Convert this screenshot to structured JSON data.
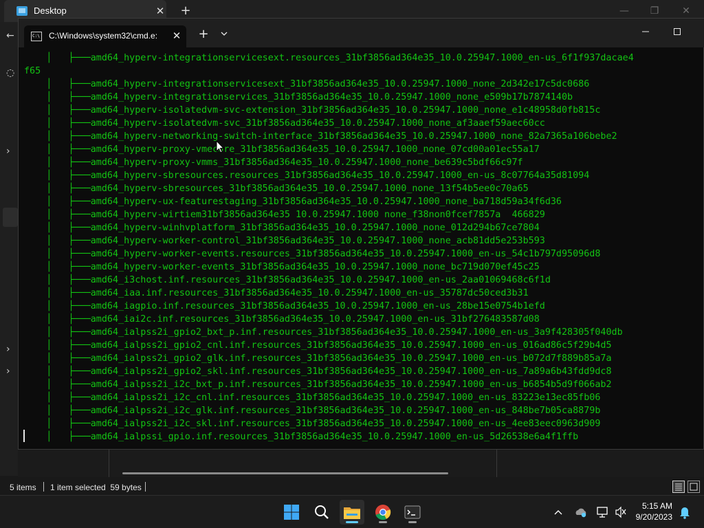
{
  "explorer": {
    "title": "Desktop",
    "close_glyph": "✕",
    "new_tab_glyph": "+",
    "status": {
      "items_count": "5 items",
      "selection": "1 item selected  59 bytes"
    },
    "icons": {
      "app": "desktop-folder-icon",
      "details_view": "details-view-icon",
      "tiles_view": "large-icons-view-icon"
    }
  },
  "terminal": {
    "tab_title": "C:\\Windows\\system32\\cmd.e:",
    "close_glyph": "✕",
    "new_tab_glyph": "+",
    "dropdown_glyph": "⌄",
    "minimize_glyph": "—",
    "maximize_glyph": "☐",
    "cmd_icon_text": "C:\\",
    "lines": [
      "    │   ├───amd64_hyperv-integrationservicesext.resources_31bf3856ad364e35_10.0.25947.1000_en-us_6f1f937dacae4",
      "f65",
      "    │   ├───amd64_hyperv-integrationservicesext_31bf3856ad364e35_10.0.25947.1000_none_2d342e17c5dc0686",
      "    │   ├───amd64_hyperv-integrationservices_31bf3856ad364e35_10.0.25947.1000_none_e509b17b7874140b",
      "    │   ├───amd64_hyperv-isolatedvm-svc-extension_31bf3856ad364e35_10.0.25947.1000_none_e1c48958d0fb815c",
      "    │   ├───amd64_hyperv-isolatedvm-svc_31bf3856ad364e35_10.0.25947.1000_none_af3aaef59aec60cc",
      "    │   ├───amd64_hyperv-networking-switch-interface_31bf3856ad364e35_10.0.25947.1000_none_82a7365a106bebe2",
      "    │   ├───amd64_hyperv-proxy-vmecore_31bf3856ad364e35_10.0.25947.1000_none_07cd00a01ec55a17",
      "    │   ├───amd64_hyperv-proxy-vmms_31bf3856ad364e35_10.0.25947.1000_none_be639c5bdf66c97f",
      "    │   ├───amd64_hyperv-sbresources.resources_31bf3856ad364e35_10.0.25947.1000_en-us_8c07764a35d81094",
      "    │   ├───amd64_hyperv-sbresources_31bf3856ad364e35_10.0.25947.1000_none_13f54b5ee0c70a65",
      "    │   ├───amd64_hyperv-ux-featurestaging_31bf3856ad364e35_10.0.25947.1000_none_ba718d59a34f6d36",
      "    │   ├───amd64_hyperv-wirtiem31bf3856ad364e35 10.0.25947.1000 none_f38non0fcef7857a  466829",
      "    │   ├───amd64_hyperv-winhvplatform_31bf3856ad364e35_10.0.25947.1000_none_012d294b67ce7804",
      "    │   ├───amd64_hyperv-worker-control_31bf3856ad364e35_10.0.25947.1000_none_acb81dd5e253b593",
      "    │   ├───amd64_hyperv-worker-events.resources_31bf3856ad364e35_10.0.25947.1000_en-us_54c1b797d95096d8",
      "    │   ├───amd64_hyperv-worker-events_31bf3856ad364e35_10.0.25947.1000_none_bc719d070ef45c25",
      "    │   ├───amd64_i3chost.inf.resources_31bf3856ad364e35_10.0.25947.1000_en-us_2aa01069468c6f1d",
      "    │   ├───amd64_iaa.inf.resources_31bf3856ad364e35_10.0.25947.1000_en-us_35787dc50ced3b31",
      "    │   ├───amd64_iagpio.inf.resources_31bf3856ad364e35_10.0.25947.1000_en-us_28be15e0754b1efd",
      "    │   ├───amd64_iai2c.inf.resources_31bf3856ad364e35_10.0.25947.1000_en-us_31bf276483587d08",
      "    │   ├───amd64_ialpss2i_gpio2_bxt_p.inf.resources_31bf3856ad364e35_10.0.25947.1000_en-us_3a9f428305f040db",
      "    │   ├───amd64_ialpss2i_gpio2_cnl.inf.resources_31bf3856ad364e35_10.0.25947.1000_en-us_016ad86c5f29b4d5",
      "    │   ├───amd64_ialpss2i_gpio2_glk.inf.resources_31bf3856ad364e35_10.0.25947.1000_en-us_b072d7f889b85a7a",
      "    │   ├───amd64_ialpss2i_gpio2_skl.inf.resources_31bf3856ad364e35_10.0.25947.1000_en-us_7a89a6b43fdd9dc8",
      "    │   ├───amd64_ialpss2i_i2c_bxt_p.inf.resources_31bf3856ad364e35_10.0.25947.1000_en-us_b6854b5d9f066ab2",
      "    │   ├───amd64_ialpss2i_i2c_cnl.inf.resources_31bf3856ad364e35_10.0.25947.1000_en-us_83223e13ec85fb06",
      "    │   ├───amd64_ialpss2i_i2c_glk.inf.resources_31bf3856ad364e35_10.0.25947.1000_en-us_848be7b05ca8879b",
      "    │   ├───amd64_ialpss2i_i2c_skl.inf.resources_31bf3856ad364e35_10.0.25947.1000_en-us_4ee83eec0963d909",
      "    │   ├───amd64_ialpssi_gpio.inf.resources_31bf3856ad364e35_10.0.25947.1000_en-us_5d26538e6a4f1ffb"
    ]
  },
  "taskbar": {
    "time": "5:15 AM",
    "date": "9/20/2023",
    "apps": [
      "start-icon",
      "search-icon",
      "file-explorer-icon",
      "chrome-icon",
      "terminal-icon"
    ],
    "tray": [
      "chevron-up-icon",
      "onedrive-icon",
      "network-icon",
      "volume-muted-icon",
      "notification-bell-icon"
    ],
    "colors": {
      "accent": "#60cdff",
      "terminal_text": "#13c313"
    }
  }
}
